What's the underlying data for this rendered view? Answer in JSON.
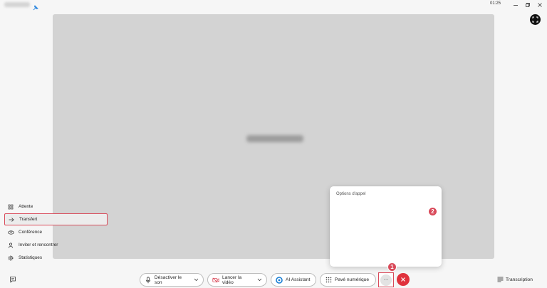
{
  "titlebar": {
    "clock": "01:25",
    "icons": [
      "pin-icon",
      "minimize-icon",
      "restore-icon",
      "close-icon",
      "fullscreen-icon"
    ]
  },
  "call_menu": {
    "header": "Options d'appel",
    "items": [
      {
        "label": "Attente",
        "icon": "hold-icon"
      },
      {
        "label": "Transfert",
        "icon": "arrow-right-icon"
      },
      {
        "label": "Conférence",
        "icon": "conference-icon"
      },
      {
        "label": "Inviter et rencontrer",
        "icon": "person-icon"
      },
      {
        "label": "Statistiques",
        "icon": "gear-icon"
      }
    ]
  },
  "callouts": [
    "1",
    "2"
  ],
  "toolbar": {
    "mute_label": "Désactiver le son",
    "video_label": "Lancer la vidéo",
    "ai_label": "AI Assistant",
    "keypad_label": "Pavé numérique",
    "more_label": "···",
    "transcription_label": "Transcription"
  },
  "colors": {
    "accent_red": "#d94a5a",
    "hangup_red": "#e0323d",
    "video_bg": "#d3d3d3",
    "ai_blue": "#1a7fd4"
  }
}
